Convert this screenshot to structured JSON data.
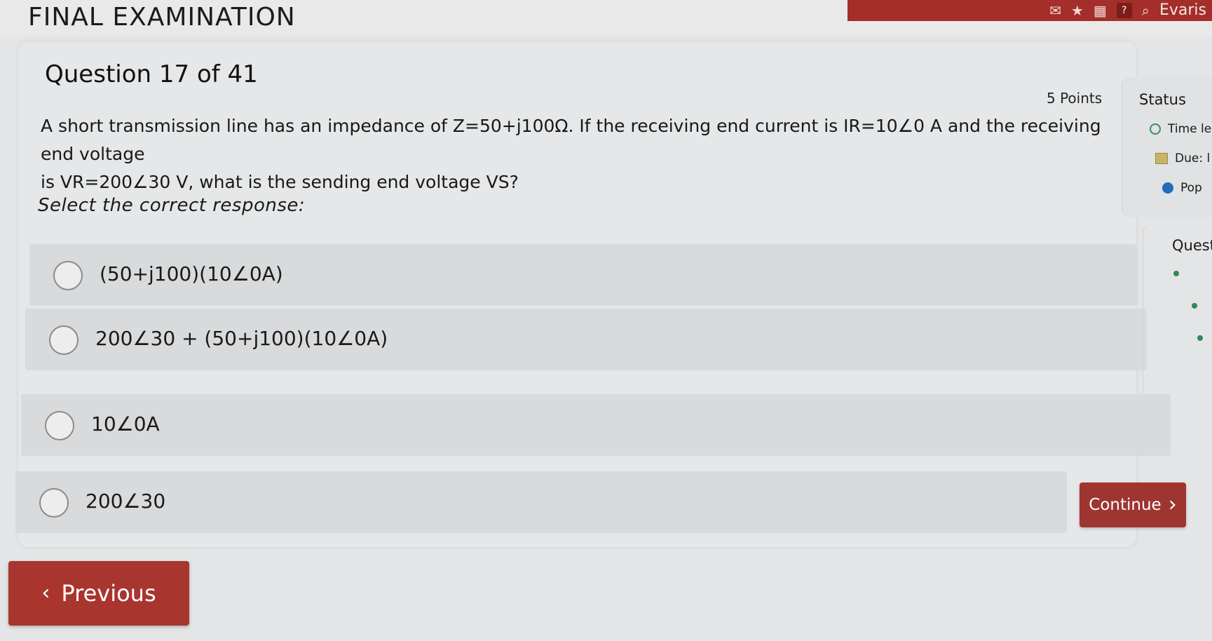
{
  "header": {
    "title": "FINAL EXAMINATION",
    "user": "Evaris",
    "help_label": "?"
  },
  "question": {
    "heading": "Question 17 of 41",
    "points": "5 Points",
    "text_part1": "A short transmission line has an impedance of Z=50+j100Ω. If the receiving end current is IR=10∠0 A and the receiving end voltage",
    "text_part2": "is VR=200∠30 V, what is the sending end voltage VS?",
    "select_label": "Select the correct response:"
  },
  "options": [
    {
      "label": "(50+j100)(10∠0A)"
    },
    {
      "label": "200∠30 + (50+j100)(10∠0A)"
    },
    {
      "label": "10∠0A"
    },
    {
      "label": "200∠30"
    }
  ],
  "status": {
    "title": "Status",
    "time_label": "Time le",
    "due_label": "Due: l",
    "pop_label": "Pop"
  },
  "questions_panel": {
    "label": "Quest"
  },
  "buttons": {
    "continue": "Continue",
    "previous": "Previous"
  },
  "colors": {
    "accent": "#a9352f",
    "header_red": "#a32e2a",
    "status_green": "#2f8a56"
  }
}
